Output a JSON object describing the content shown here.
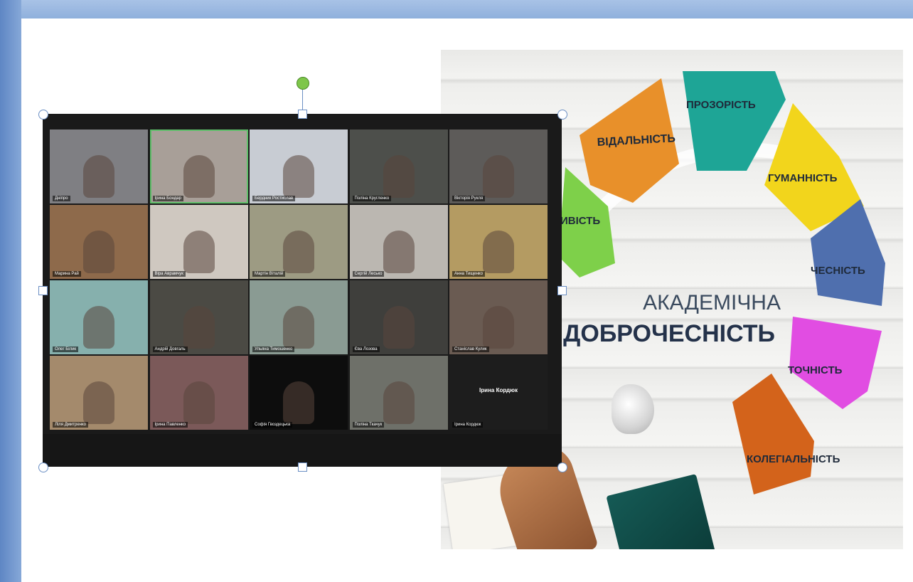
{
  "poster": {
    "title_line1": "АКАДЕМІЧНА",
    "title_line2": "ДОБРОЧЕСНІСТЬ",
    "petals": [
      {
        "label": "ВІДАЛЬНІСТЬ",
        "color": "#e8902a"
      },
      {
        "label": "ПРОЗОРІСТЬ",
        "color": "#1ea596"
      },
      {
        "label": "ГУМАННІСТЬ",
        "color": "#f2d51c"
      },
      {
        "label": "ИВІСТЬ",
        "color": "#7ed04a"
      },
      {
        "label": "ЧЕСНІСТЬ",
        "color": "#4f6fae"
      },
      {
        "label": "ТОЧНІСТЬ",
        "color": "#e14de2"
      },
      {
        "label": "КОЛЕГІАЛЬНІСТЬ",
        "color": "#d3631b"
      }
    ]
  },
  "zoom": {
    "grid": [
      [
        {
          "name": "Дніпро",
          "bg": "#7f7f83"
        },
        {
          "name": "Ірина Бондар",
          "bg": "#a89f98",
          "active": true
        },
        {
          "name": "Бердник Ростислав",
          "bg": "#c8ccd3"
        },
        {
          "name": "Поліна Кругленко",
          "bg": "#4d4f4b"
        },
        {
          "name": "Вікторія Рукля",
          "bg": "#5d5b59"
        }
      ],
      [
        {
          "name": "Марина Рай",
          "bg": "#8e6a4b"
        },
        {
          "name": "Віра Аврамчук",
          "bg": "#cfc8c0"
        },
        {
          "name": "Мартін Віталій",
          "bg": "#9d9b83"
        },
        {
          "name": "Сергій Лесько",
          "bg": "#bbb7b1"
        },
        {
          "name": "Анна Тищенко",
          "bg": "#b49b62"
        }
      ],
      [
        {
          "name": "Олег Білик",
          "bg": "#86b0ad"
        },
        {
          "name": "Андрій Довгаль",
          "bg": "#4b4a44"
        },
        {
          "name": "Ульяна Тимошенко",
          "bg": "#8a9b93"
        },
        {
          "name": "Єва Лозова",
          "bg": "#3f3f3c"
        },
        {
          "name": "Станіслав Кулик",
          "bg": "#6a5b52"
        }
      ],
      [
        {
          "name": "Ліля Дмитренко",
          "bg": "#a48a6c"
        },
        {
          "name": "Ірина Павленко",
          "bg": "#7b5959"
        },
        {
          "name": "Софія Гвоздецька",
          "bg": "#0d0d0d"
        },
        {
          "name": "Поліна Ткачук",
          "bg": "#6e7069"
        },
        {
          "name": "Ірина Кордюк",
          "bg": "#1d1d1d",
          "center_name": "Ірина Кордюк"
        }
      ]
    ]
  }
}
